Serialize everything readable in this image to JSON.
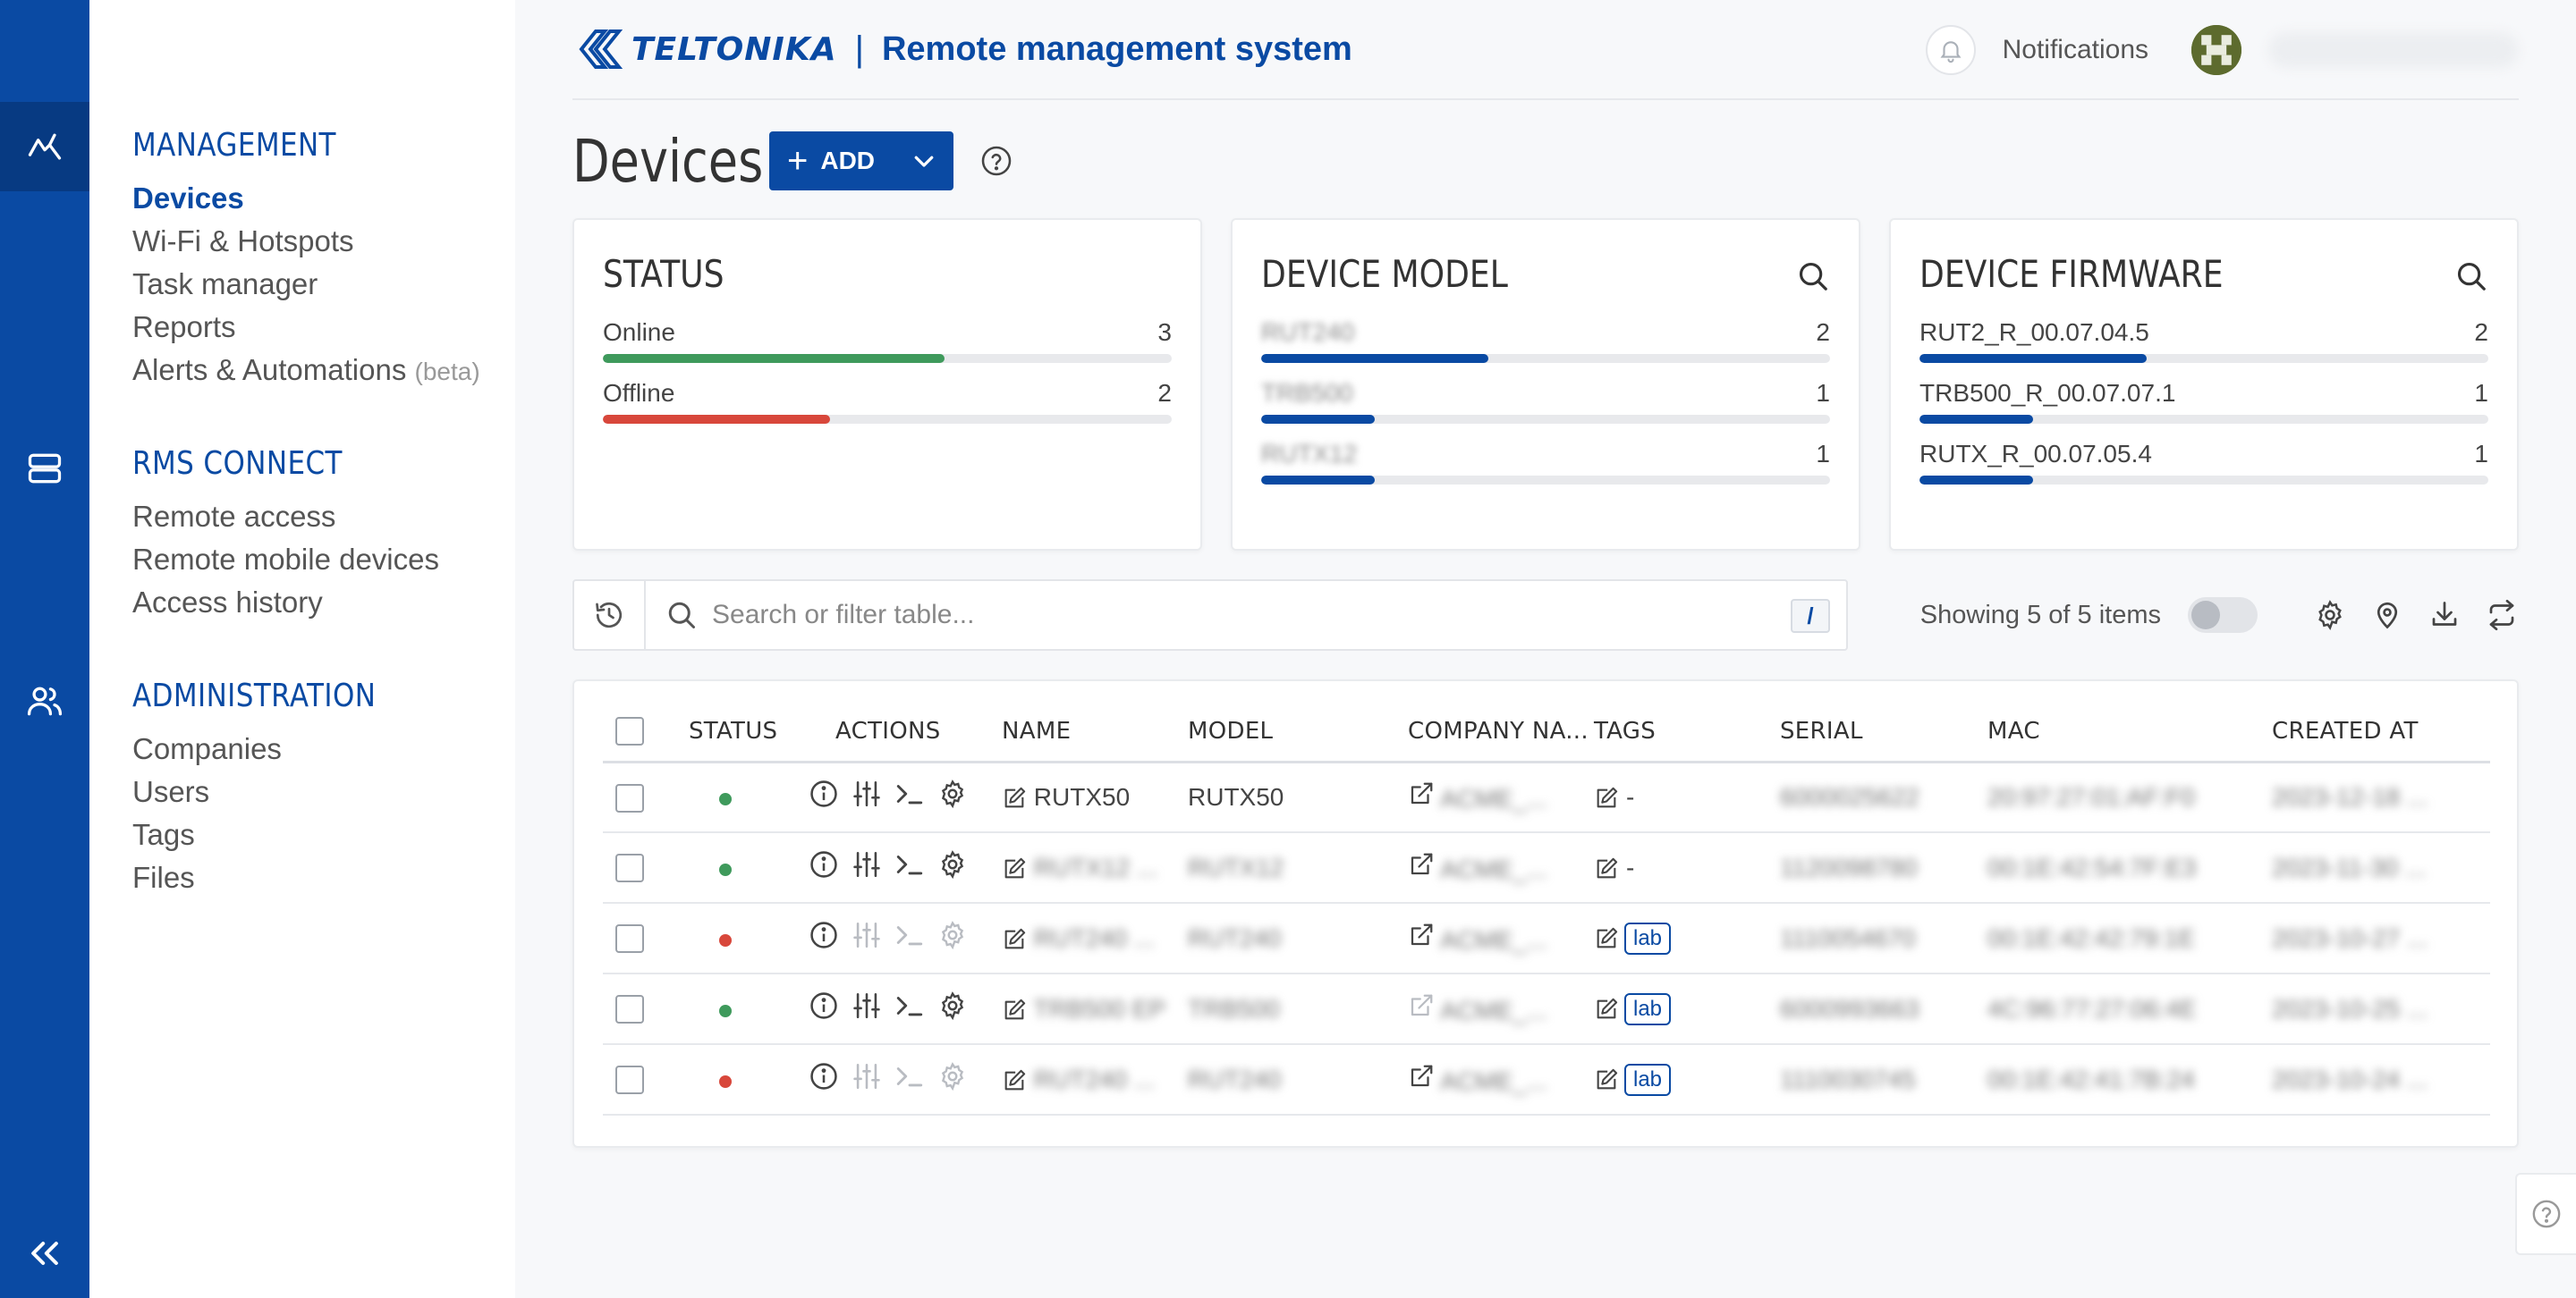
{
  "brand": {
    "logo_text": "TELTONIKA",
    "separator": "|",
    "app_title": "Remote management system"
  },
  "colors": {
    "primary": "#0a4aa3",
    "online": "#3f9a5c",
    "offline": "#d8473b",
    "bar_track": "#e8e9ec"
  },
  "rail": {
    "items": [
      {
        "name": "analytics",
        "icon": "chart-line-icon",
        "active": true
      },
      {
        "name": "devices",
        "icon": "server-icon",
        "active": false
      },
      {
        "name": "users",
        "icon": "users-icon",
        "active": false
      }
    ],
    "collapse_icon": "double-chevron-left-icon"
  },
  "sidemenu": {
    "management": {
      "title": "MANAGEMENT",
      "items": [
        "Devices",
        "Wi-Fi & Hotspots",
        "Task manager",
        "Reports",
        "Alerts & Automations"
      ],
      "beta": "(beta)"
    },
    "rms_connect": {
      "title": "RMS CONNECT",
      "items": [
        "Remote access",
        "Remote mobile devices",
        "Access history"
      ]
    },
    "administration": {
      "title": "ADMINISTRATION",
      "items": [
        "Companies",
        "Users",
        "Tags",
        "Files"
      ]
    }
  },
  "topbar": {
    "notifications": "Notifications"
  },
  "page": {
    "title": "Devices",
    "add_label": "ADD"
  },
  "cards": {
    "status": {
      "title": "STATUS",
      "rows": [
        {
          "label": "Online",
          "count": "3",
          "fraction": 0.6
        },
        {
          "label": "Offline",
          "count": "2",
          "fraction": 0.4
        }
      ]
    },
    "device_model": {
      "title": "DEVICE MODEL",
      "rows": [
        {
          "label": "RUT240",
          "count": "2",
          "fraction": 0.4
        },
        {
          "label": "TRB500",
          "count": "1",
          "fraction": 0.2
        },
        {
          "label": "RUTX12",
          "count": "1",
          "fraction": 0.2
        }
      ]
    },
    "device_firmware": {
      "title": "DEVICE FIRMWARE",
      "rows": [
        {
          "label": "RUT2_R_00.07.04.5",
          "count": "2",
          "fraction": 0.4
        },
        {
          "label": "TRB500_R_00.07.07.1",
          "count": "1",
          "fraction": 0.2
        },
        {
          "label": "RUTX_R_00.07.05.4",
          "count": "1",
          "fraction": 0.2
        }
      ]
    }
  },
  "toolbar": {
    "search_placeholder": "Search or filter table...",
    "shortcut_key": "/",
    "showing": "Showing 5 of 5 items"
  },
  "table": {
    "headers": [
      "STATUS",
      "ACTIONS",
      "NAME",
      "MODEL",
      "COMPANY NA...",
      "TAGS",
      "SERIAL",
      "MAC",
      "CREATED AT"
    ],
    "rows": [
      {
        "status": "online",
        "actions_enabled": true,
        "name": "RUTX50",
        "name_blurred": false,
        "model": "RUTX50",
        "model_blurred": false,
        "company": "ACME_...",
        "tag": "-",
        "serial": "6000025622",
        "mac": "20:97:27:01:AF:F0",
        "created": "2023-12-18 ..."
      },
      {
        "status": "online",
        "actions_enabled": true,
        "name": "RUTX12 ...",
        "name_blurred": true,
        "model": "RUTX12",
        "model_blurred": true,
        "company": "ACME_...",
        "tag": "-",
        "serial": "1120098780",
        "mac": "00:1E:42:54:7F:E3",
        "created": "2023-11-30 ..."
      },
      {
        "status": "offline",
        "actions_enabled": false,
        "name": "RUT240 ...",
        "name_blurred": true,
        "model": "RUT240",
        "model_blurred": true,
        "company": "ACME_...",
        "tag": "lab",
        "serial": "1110054670",
        "mac": "00:1E:42:42:79:1E",
        "created": "2023-10-27 ..."
      },
      {
        "status": "online",
        "actions_enabled": true,
        "name": "TRB500 EP",
        "name_blurred": true,
        "model": "TRB500",
        "model_blurred": true,
        "company": "ACME_...",
        "tag": "lab",
        "serial": "6000993663",
        "mac": "4C:96:77:27:06:4E",
        "created": "2023-10-25 ..."
      },
      {
        "status": "offline",
        "actions_enabled": false,
        "name": "RUT240 ...",
        "name_blurred": true,
        "model": "RUT240",
        "model_blurred": true,
        "company": "ACME_...",
        "tag": "lab",
        "serial": "1110030745",
        "mac": "00:1E:42:41:7B:24",
        "created": "2023-10-24 ..."
      }
    ]
  }
}
